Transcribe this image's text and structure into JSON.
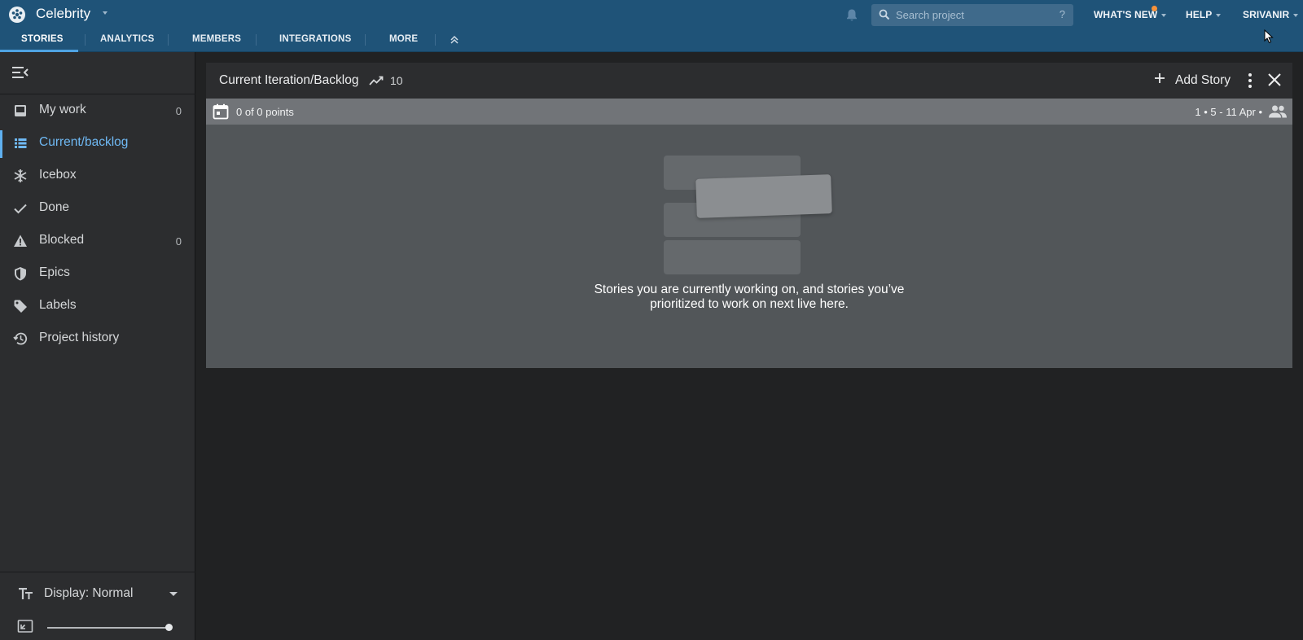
{
  "app": {
    "project_name": "Celebrity",
    "search_placeholder": "Search project",
    "search_help": "?",
    "whats_new": "WHAT'S NEW",
    "help": "HELP",
    "user": "SRIVANIR"
  },
  "tabs": [
    {
      "label": "STORIES",
      "active": true
    },
    {
      "label": "ANALYTICS"
    },
    {
      "label": "MEMBERS"
    },
    {
      "label": "INTEGRATIONS"
    },
    {
      "label": "MORE"
    }
  ],
  "sidebar": {
    "items": [
      {
        "label": "My work",
        "icon": "inbox-icon",
        "count": "0"
      },
      {
        "label": "Current/backlog",
        "icon": "list-icon",
        "active": true
      },
      {
        "label": "Icebox",
        "icon": "snowflake-icon"
      },
      {
        "label": "Done",
        "icon": "check-icon"
      },
      {
        "label": "Blocked",
        "icon": "warning-icon",
        "count": "0"
      },
      {
        "label": "Epics",
        "icon": "shield-icon"
      },
      {
        "label": "Labels",
        "icon": "tag-icon"
      },
      {
        "label": "Project history",
        "icon": "history-icon"
      }
    ],
    "display_label": "Display: Normal"
  },
  "panel": {
    "title": "Current Iteration/Backlog",
    "velocity": "10",
    "add_story": "Add Story",
    "points": "0 of 0 points",
    "iteration_dates": "1 • 5 - 11 Apr •",
    "empty_message": "Stories you are currently working on, and stories you’ve prioritized to work on next live here."
  },
  "colors": {
    "header_bg": "#1f5378",
    "accent": "#5fb0f0",
    "notification_dot": "#f7923a"
  },
  "zoom_level": 1.0
}
